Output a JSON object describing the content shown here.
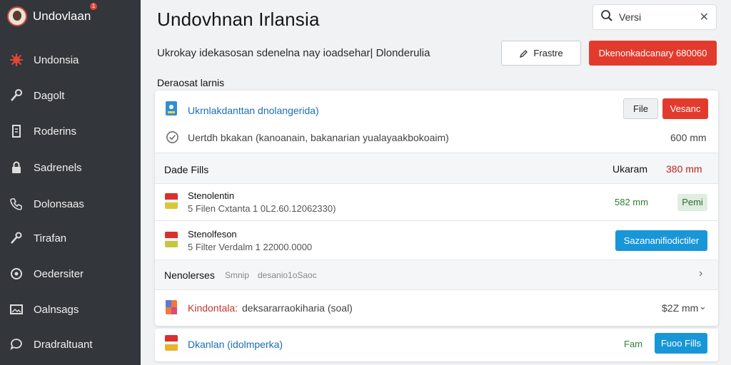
{
  "app": {
    "name": "Undovlaan",
    "badge": "1"
  },
  "sidebar": {
    "items": [
      {
        "label": "Undonsia",
        "icon": "virus-icon"
      },
      {
        "label": "Dagolt",
        "icon": "key-icon"
      },
      {
        "label": "Roderins",
        "icon": "document-icon"
      },
      {
        "label": "Sadrenels",
        "icon": "lock-icon"
      },
      {
        "label": "Dolonsaas",
        "icon": "phone-icon"
      },
      {
        "label": "Tirafan",
        "icon": "wrench-icon"
      },
      {
        "label": "Oedersiter",
        "icon": "settings-icon"
      },
      {
        "label": "Oalnsags",
        "icon": "image-icon"
      },
      {
        "label": "Dradraltuant",
        "icon": "chat-icon"
      }
    ]
  },
  "header": {
    "title": "Undovhnan Irlansia",
    "search_value": "Versi",
    "subtitle": "Ukrokay idekasosan sdenelna nay ioadsehar| Dlonderulia",
    "outline_button": "Frastre",
    "primary_button": "Dkenonkadcanary 680060"
  },
  "section": {
    "title": "Deraosat larnis"
  },
  "panel": {
    "row1": {
      "link": "Ukrnlakdanttan dnolangerida)",
      "btn_file": "File",
      "btn_red": "Vesanc",
      "desc": "Uertdh bkakan (kanoanain, bakanarian yualayaakbokoaim)",
      "size": "600 mm"
    },
    "row2": {
      "label": "Dade Fills",
      "col_label": "Ukaram",
      "col_value": "380 mm"
    },
    "row3": {
      "name": "Stenolentin",
      "meta": "5 Filen Cxtanta 1 0L2.60.12062330)",
      "size": "582 mm",
      "chip": "Pemi"
    },
    "row4": {
      "name": "Stenolfeson",
      "meta": "5 Filter Verdalm 1 22000.0000",
      "btn": "Sazananifiodictiler"
    },
    "row5": {
      "label": "Nenolerses",
      "muted": "Smnip",
      "muted2": "desanio1oSaoc"
    },
    "row6": {
      "link": "Kindontala:",
      "desc": "deksararraokiharia (soal)",
      "size": "$2Z mm"
    }
  },
  "bottom": {
    "link": "Dkanlan (idolmperka)",
    "status": "Fam",
    "btn": "Fuoo Fills"
  },
  "colors": {
    "sidebar": "#33363b",
    "primary_red": "#e23b2e",
    "link_blue": "#1a6fb5",
    "button_blue": "#1896d8",
    "green_text": "#2f7d32"
  }
}
